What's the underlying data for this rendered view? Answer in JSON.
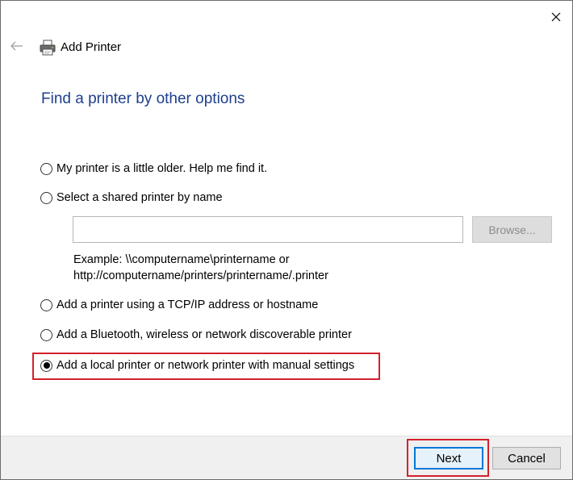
{
  "window": {
    "title": "Add Printer",
    "close_icon": "close-icon",
    "back_icon": "back-arrow-icon",
    "printer_icon": "printer-icon"
  },
  "heading": "Find a printer by other options",
  "options": [
    {
      "label": "My printer is a little older. Help me find it.",
      "selected": false
    },
    {
      "label": "Select a shared printer by name",
      "selected": false
    },
    {
      "label": "Add a printer using a TCP/IP address or hostname",
      "selected": false
    },
    {
      "label": "Add a Bluetooth, wireless or network discoverable printer",
      "selected": false
    },
    {
      "label": "Add a local printer or network printer with manual settings",
      "selected": true
    }
  ],
  "shared_printer": {
    "input_value": "",
    "browse_label": "Browse...",
    "example_line1": "Example: \\\\computername\\printername or",
    "example_line2": "http://computername/printers/printername/.printer"
  },
  "footer": {
    "next_label": "Next",
    "cancel_label": "Cancel"
  },
  "colors": {
    "heading": "#1e3f8f",
    "highlight": "#d3212c",
    "default_button_border": "#0078d7"
  }
}
